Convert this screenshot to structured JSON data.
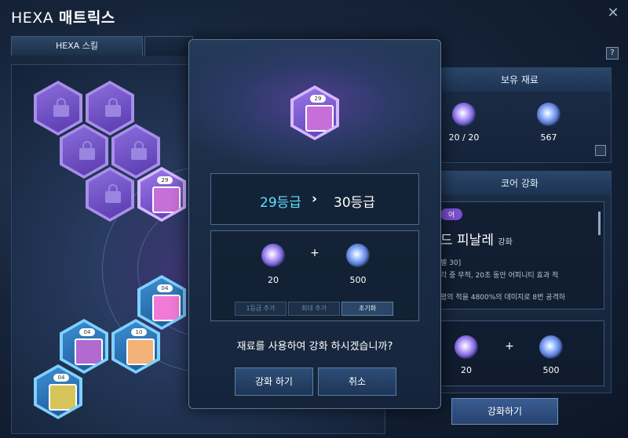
{
  "window": {
    "title_prefix": "HEXA",
    "title_main": "매트릭스",
    "close": "✕"
  },
  "tabs": [
    {
      "label": "HEXA 스킬"
    },
    {
      "label": ""
    }
  ],
  "help": "?",
  "hex_grid": [
    {
      "state": "locked"
    },
    {
      "state": "locked"
    },
    {
      "state": "locked"
    },
    {
      "state": "locked"
    },
    {
      "state": "locked"
    },
    {
      "state": "active",
      "level": "29"
    },
    {
      "state": "blue",
      "level": "04"
    },
    {
      "state": "blue",
      "level": "04"
    },
    {
      "state": "blue",
      "level": "10"
    },
    {
      "state": "blue",
      "level": "04"
    }
  ],
  "owned": {
    "header": "보유 재료",
    "qty1": "20 / 20",
    "qty2": "567"
  },
  "core": {
    "header": "코어 강화",
    "tag": "어",
    "skill_name": "드 피날레",
    "skill_suffix": "강화",
    "desc1": "벨 30]",
    "desc2": "각 중 무적, 20초 동안 어피니티 효과 적",
    "desc3": "평의 적을 4800%의 데미지로 8번 공격하",
    "cost1": "20",
    "cost2": "500",
    "plus": "+"
  },
  "modal": {
    "badge": "29",
    "grade_from": "29등급",
    "arrow": "›",
    "grade_to": "30등급",
    "cost1": "20",
    "cost2": "500",
    "plus": "+",
    "btn_add1": "1등급 추가",
    "btn_max": "최대 추가",
    "btn_reset": "초기화",
    "question": "재료를 사용하여 강화 하시겠습니까?",
    "confirm": "강화 하기",
    "cancel": "취소"
  },
  "enhance_button": "강화하기",
  "colors": {
    "grade_from": "#5fe0ff",
    "grade_to": "#ffffff",
    "accent_purple": "#8a6ddc",
    "accent_blue": "#3c8ed2"
  }
}
